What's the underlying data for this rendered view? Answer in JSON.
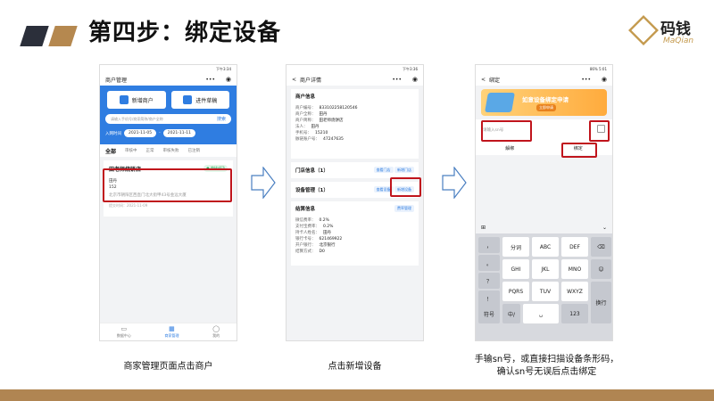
{
  "slide": {
    "title": "第四步：绑定设备",
    "logo_name": "码钱",
    "logo_en": "MaQian",
    "accent_color": "#b08552",
    "dark_color": "#2b2f3a",
    "highlight_color": "#c0141c"
  },
  "phone1": {
    "status": "下午3:34",
    "nav_title": "商户管理",
    "nav_dots": "•••",
    "nav_record": "◉",
    "btn_add": "新增商户",
    "btn_draft": "进件草稿",
    "search_placeholder": "请输入手机号/商家简称/商户全称",
    "search_btn": "搜索",
    "date_label": "入网时间",
    "date_from": "2021-11-05",
    "date_sep": "-",
    "date_to": "2021-11-11",
    "tabs": [
      "全部",
      "审核中",
      "正常",
      "审核失败",
      "已注销"
    ],
    "card_name": "田老师烧饼店",
    "card_badge": "● 审核成功",
    "card_line1": "田丹",
    "card_line2": "152",
    "card_line3": "北京市朝阳区西直门北大街甲43号金远大厦",
    "card_line4": "提交时间：2021-11-09",
    "tabbar": [
      {
        "icon": "▭",
        "label": "数据中心"
      },
      {
        "icon": "▦",
        "label": "商家管理"
      },
      {
        "icon": "◯",
        "label": "我的"
      }
    ],
    "caption": "商家管理页面点击商户"
  },
  "phone2": {
    "status": "下午3:36",
    "nav_back": "<",
    "nav_title": "商户详情",
    "nav_dots": "•••",
    "nav_record": "◉",
    "sec_merchant": "商户信息",
    "kv": [
      {
        "k": "商户编号：",
        "v": "833102258120546"
      },
      {
        "k": "商户全称：",
        "v": "田丹"
      },
      {
        "k": "商户简称：",
        "v": "田老师烧饼店"
      },
      {
        "k": "法人：",
        "v": "田丹"
      },
      {
        "k": "手机号：",
        "v": "15210"
      },
      {
        "k": "脉链账户号：",
        "v": "47247635"
      }
    ],
    "store": "门店信息（1）",
    "store_view": "查看门店",
    "store_add": "新增门店",
    "device": "设备管理（1）",
    "device_view": "查看设备",
    "device_add": "新增设备",
    "settle": "结算信息",
    "settle_tag": "费率管理",
    "settle_kv": [
      {
        "k": "微信费率：",
        "v": "0.2%"
      },
      {
        "k": "支付宝费率：",
        "v": "0.2%"
      },
      {
        "k": "持卡人姓名：",
        "v": "田丹"
      },
      {
        "k": "银行卡号：",
        "v": "621469922"
      },
      {
        "k": "开户银行：",
        "v": "北京银行"
      },
      {
        "k": "结算方式：",
        "v": "D0"
      }
    ],
    "caption": "点击新增设备"
  },
  "phone3": {
    "status": "86% 5:01",
    "nav_back": "<",
    "nav_title": "绑定",
    "nav_dots": "•••",
    "nav_record": "◉",
    "banner_title": "如意设备绑定申请",
    "banner_sub": "立即申请",
    "input_placeholder": "请输入sn号",
    "unbind": "解绑",
    "bind": "绑定",
    "kb_left": "⊞",
    "kb_right": "⌄",
    "keys_side": [
      "，",
      "。",
      "？",
      "！"
    ],
    "keys": [
      "分词",
      "ABC",
      "DEF",
      "GHI",
      "JKL",
      "MNO",
      "PQRS",
      "TUV",
      "WXYZ"
    ],
    "key_del": "⌫",
    "key_emoji": "☺",
    "key_newline": "换行",
    "key_sym": "符号",
    "key_lang": "中/",
    "key_space": "␣",
    "key_num": "123",
    "caption_l1": "手输sn号，或直接扫描设备条形码，",
    "caption_l2": "确认sn号无误后点击绑定"
  }
}
